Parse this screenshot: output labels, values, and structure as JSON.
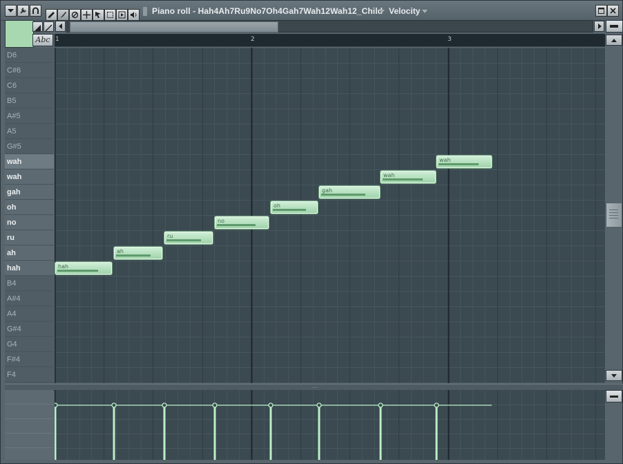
{
  "window": {
    "title": "Piano roll - Hah4Ah7Ru9No7Oh4Gah7Wah12Wah12_Child",
    "target_label": "Velocity",
    "abc_label": "Abc"
  },
  "ruler": {
    "bars": [
      "1",
      "2",
      "3"
    ]
  },
  "keys": [
    {
      "label": "D6",
      "lyric": false
    },
    {
      "label": "C#6",
      "lyric": false
    },
    {
      "label": "C6",
      "lyric": false
    },
    {
      "label": "B5",
      "lyric": false
    },
    {
      "label": "A#5",
      "lyric": false
    },
    {
      "label": "A5",
      "lyric": false
    },
    {
      "label": "G#5",
      "lyric": false
    },
    {
      "label": "wah",
      "lyric": true
    },
    {
      "label": "wah",
      "lyric": true
    },
    {
      "label": "gah",
      "lyric": true
    },
    {
      "label": "oh",
      "lyric": true
    },
    {
      "label": "no",
      "lyric": true
    },
    {
      "label": "ru",
      "lyric": true
    },
    {
      "label": "ah",
      "lyric": true
    },
    {
      "label": "hah",
      "lyric": true
    },
    {
      "label": "B4",
      "lyric": false
    },
    {
      "label": "A#4",
      "lyric": false
    },
    {
      "label": "A4",
      "lyric": false
    },
    {
      "label": "G#4",
      "lyric": false
    },
    {
      "label": "G4",
      "lyric": false
    },
    {
      "label": "F#4",
      "lyric": false
    },
    {
      "label": "F4",
      "lyric": false
    }
  ],
  "notes": [
    {
      "label": "hah",
      "row": 14,
      "start": 0.0,
      "length": 1.17,
      "velocity": 0.78
    },
    {
      "label": "ah",
      "row": 13,
      "start": 1.19,
      "length": 1.0,
      "velocity": 0.78
    },
    {
      "label": "ru",
      "row": 12,
      "start": 2.22,
      "length": 1.0,
      "velocity": 0.78
    },
    {
      "label": "no",
      "row": 11,
      "start": 3.25,
      "length": 1.11,
      "velocity": 0.78
    },
    {
      "label": "oh",
      "row": 10,
      "start": 4.38,
      "length": 0.97,
      "velocity": 0.78
    },
    {
      "label": "gah",
      "row": 9,
      "start": 5.36,
      "length": 1.25,
      "velocity": 0.78
    },
    {
      "label": "wah",
      "row": 8,
      "start": 6.62,
      "length": 1.14,
      "velocity": 0.78
    },
    {
      "label": "wah",
      "row": 7,
      "start": 7.75,
      "length": 1.14,
      "velocity": 0.78
    }
  ],
  "colors": {
    "note_fill": "#b6e3c0",
    "grid_bg": "#3b4950",
    "stem": "#b9f0c6"
  },
  "icons": [
    "dropdown-icon",
    "wrench-icon",
    "magnet-icon",
    "pencil-icon",
    "brush-icon",
    "mute-icon",
    "slice-icon",
    "select-icon",
    "zoom-icon",
    "playback-icon",
    "speaker-icon",
    "minimize-icon",
    "close-icon"
  ]
}
